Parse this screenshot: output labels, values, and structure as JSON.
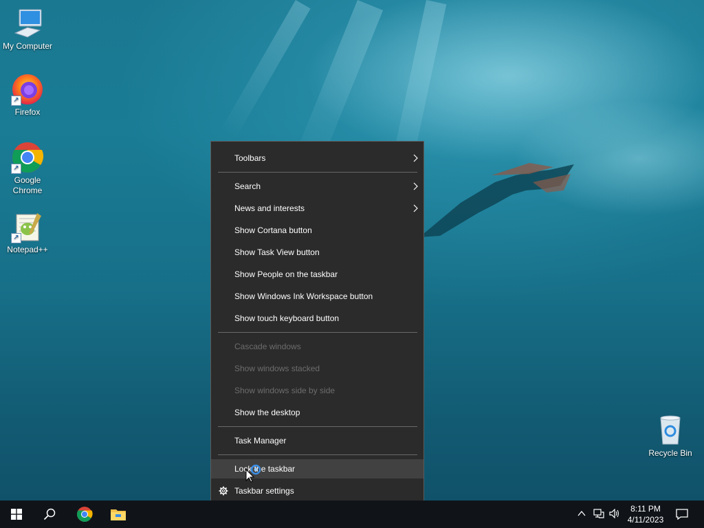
{
  "desktop": {
    "icons": [
      {
        "label": "My Computer"
      },
      {
        "label": "Firefox"
      },
      {
        "label": "Google Chrome"
      },
      {
        "label": "Notepad++"
      },
      {
        "label": "Recycle Bin"
      }
    ]
  },
  "context_menu": {
    "items": [
      {
        "label": "Toolbars",
        "submenu": true
      },
      {
        "label": "Search",
        "submenu": true
      },
      {
        "label": "News and interests",
        "submenu": true
      },
      {
        "label": "Show Cortana button"
      },
      {
        "label": "Show Task View button"
      },
      {
        "label": "Show People on the taskbar"
      },
      {
        "label": "Show Windows Ink Workspace button"
      },
      {
        "label": "Show touch keyboard button"
      },
      {
        "label": "Cascade windows",
        "disabled": true
      },
      {
        "label": "Show windows stacked",
        "disabled": true
      },
      {
        "label": "Show windows side by side",
        "disabled": true
      },
      {
        "label": "Show the desktop"
      },
      {
        "label": "Task Manager"
      },
      {
        "label": "Lock the taskbar",
        "hovered": true
      },
      {
        "label": "Taskbar settings",
        "icon": "gear-icon"
      }
    ]
  },
  "taskbar": {
    "pinned": [
      "start-icon",
      "search-icon",
      "chrome-icon",
      "file-explorer-icon"
    ],
    "tray_icons": [
      "chevron-up-icon",
      "network-icon",
      "volume-icon"
    ],
    "time": "8:11 PM",
    "date": "4/11/2023",
    "notification_icon": "action-center-icon"
  },
  "colors": {
    "menu_bg": "#2b2b2b",
    "menu_hover": "#414141",
    "taskbar_bg": "#101419",
    "disabled_text": "#6d6d6d"
  }
}
